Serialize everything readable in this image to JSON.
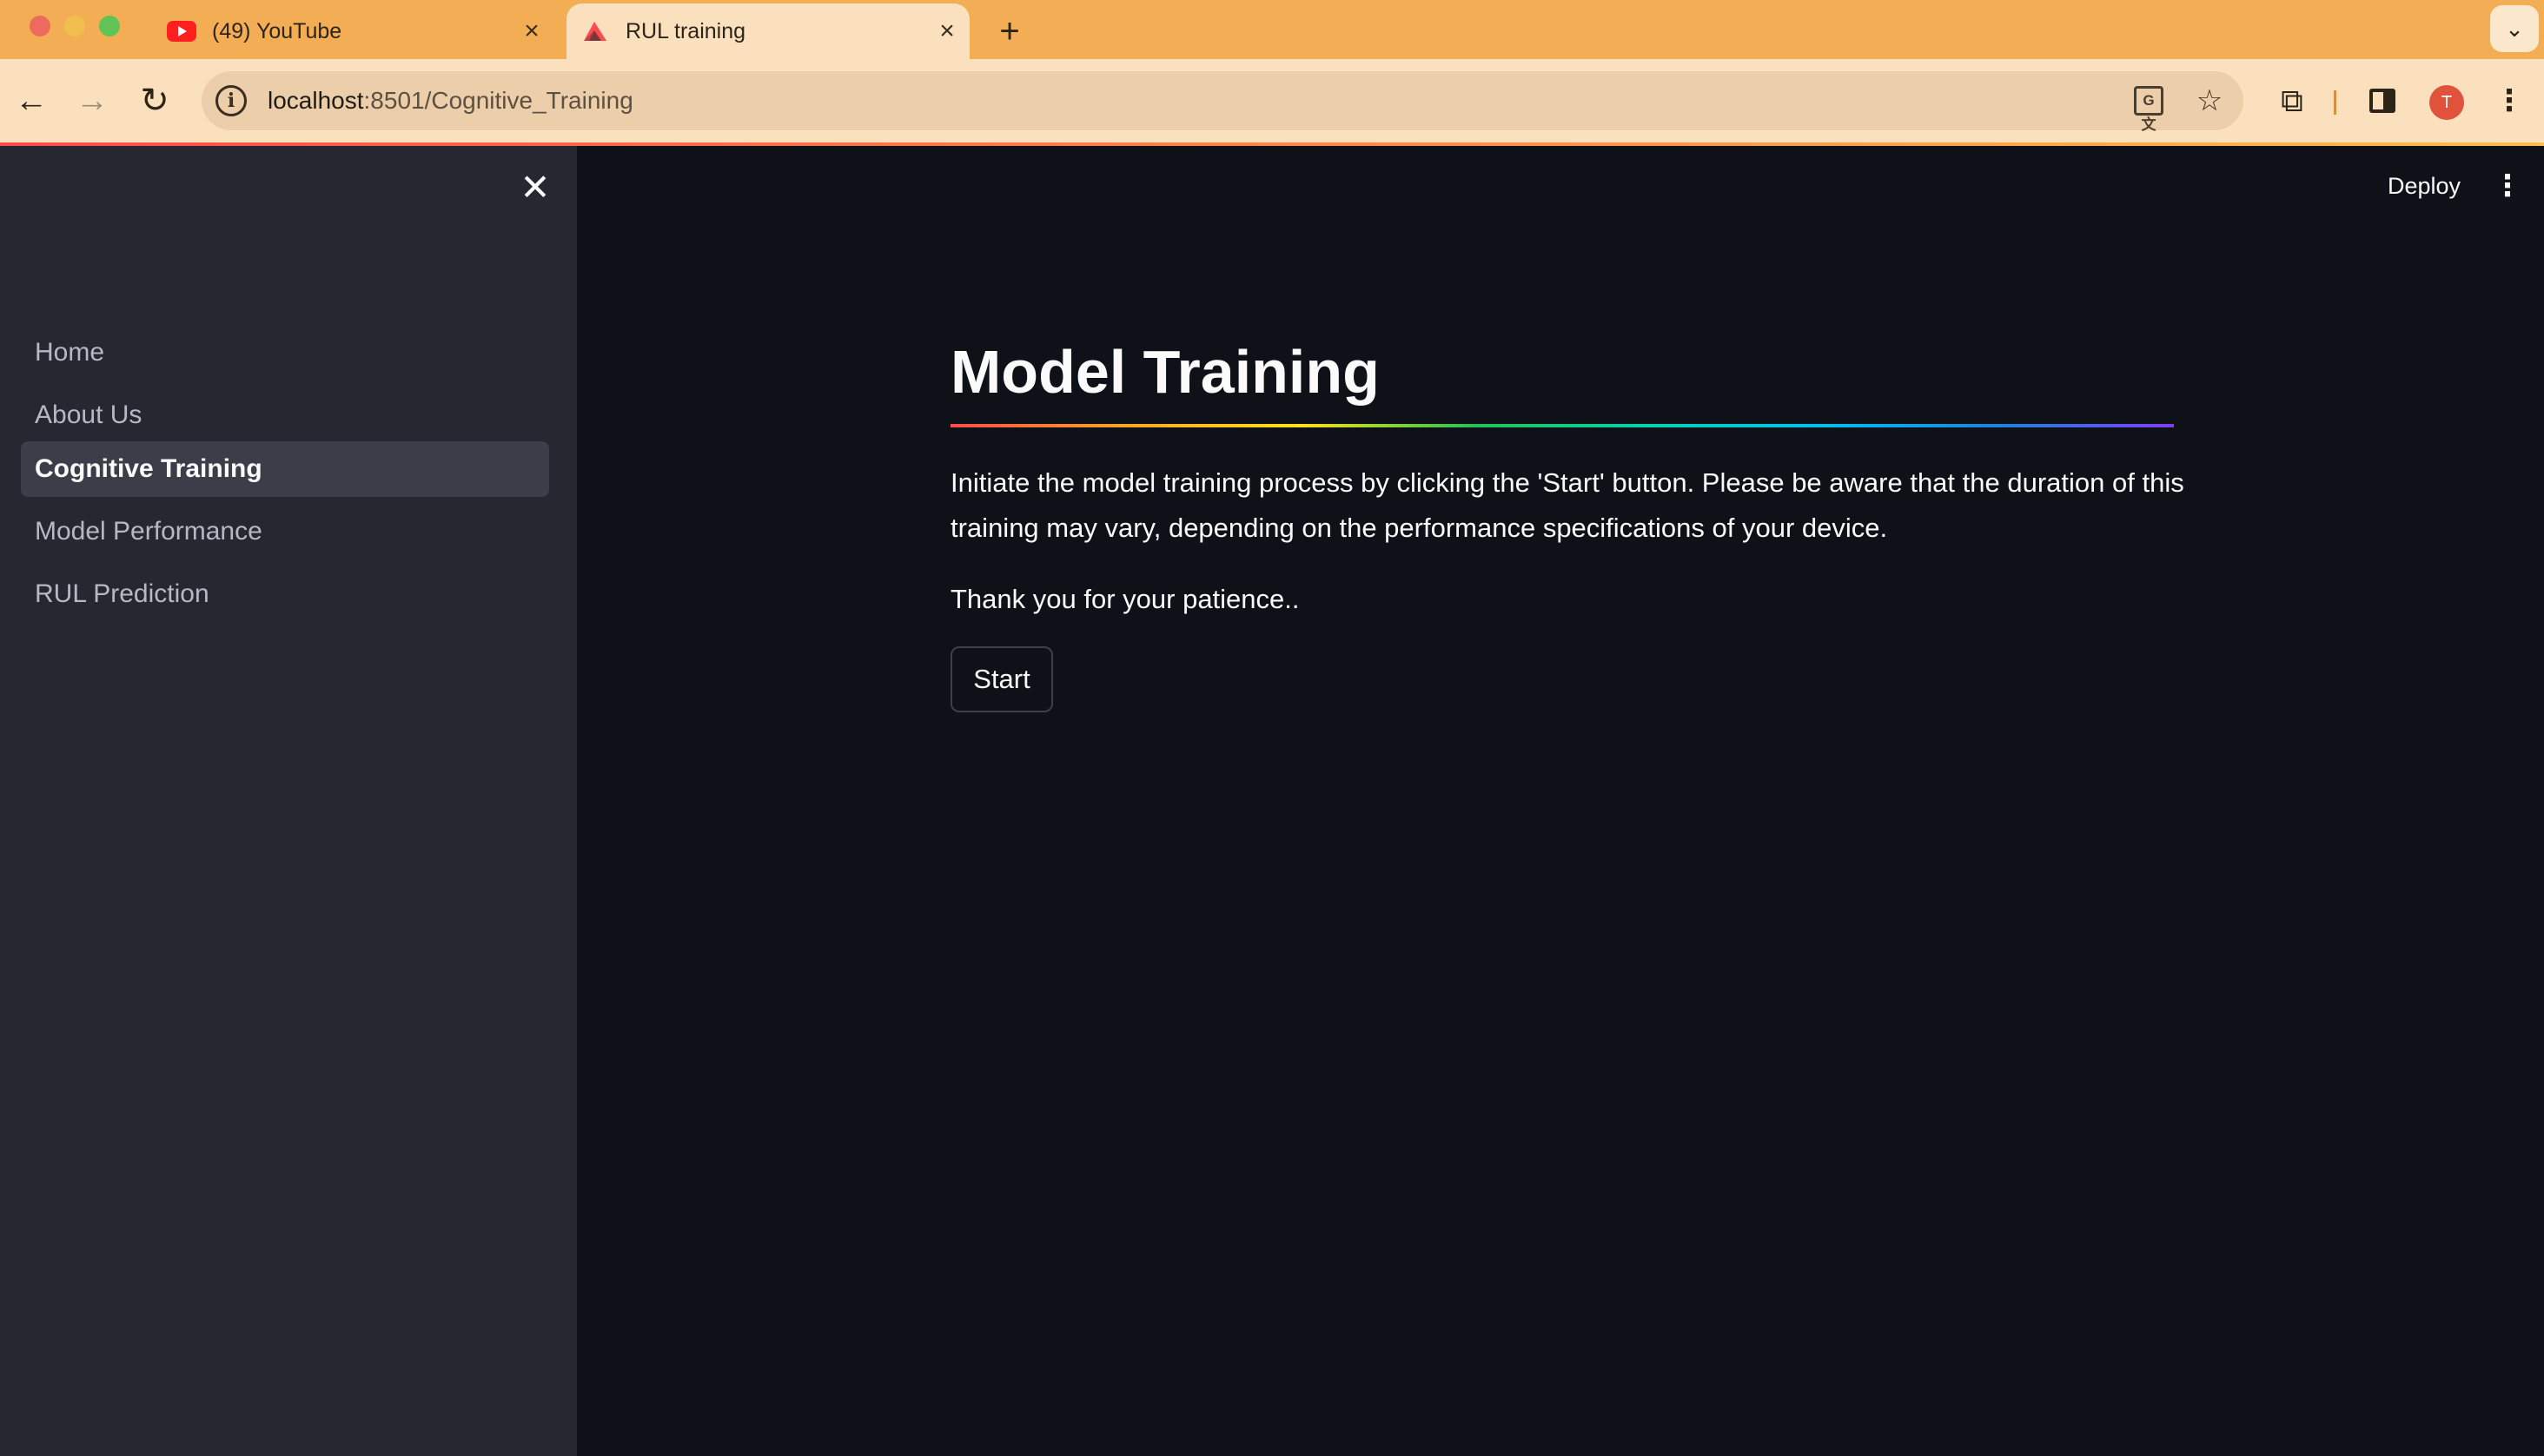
{
  "browser": {
    "tabs": [
      {
        "title": "(49) YouTube",
        "icon": "youtube-icon",
        "active": false
      },
      {
        "title": "RUL training",
        "icon": "streamlit-icon",
        "active": true
      }
    ],
    "url_host": "localhost",
    "url_path": ":8501/Cognitive_Training",
    "profile_initial": "T",
    "accent_color": "#f3ae55"
  },
  "sidebar": {
    "items": [
      {
        "label": "Home",
        "active": false
      },
      {
        "label": "About Us",
        "active": false
      },
      {
        "label": "Cognitive Training",
        "active": true
      },
      {
        "label": "Model Performance",
        "active": false
      },
      {
        "label": "RUL Prediction",
        "active": false
      }
    ]
  },
  "header": {
    "deploy_label": "Deploy"
  },
  "main": {
    "title": "Model Training",
    "paragraph_1": "Initiate the model training process by clicking the 'Start' button. Please be aware that the duration of this training may vary, depending on the performance specifications of your device.",
    "paragraph_2": "Thank you for your patience..",
    "start_label": "Start"
  }
}
